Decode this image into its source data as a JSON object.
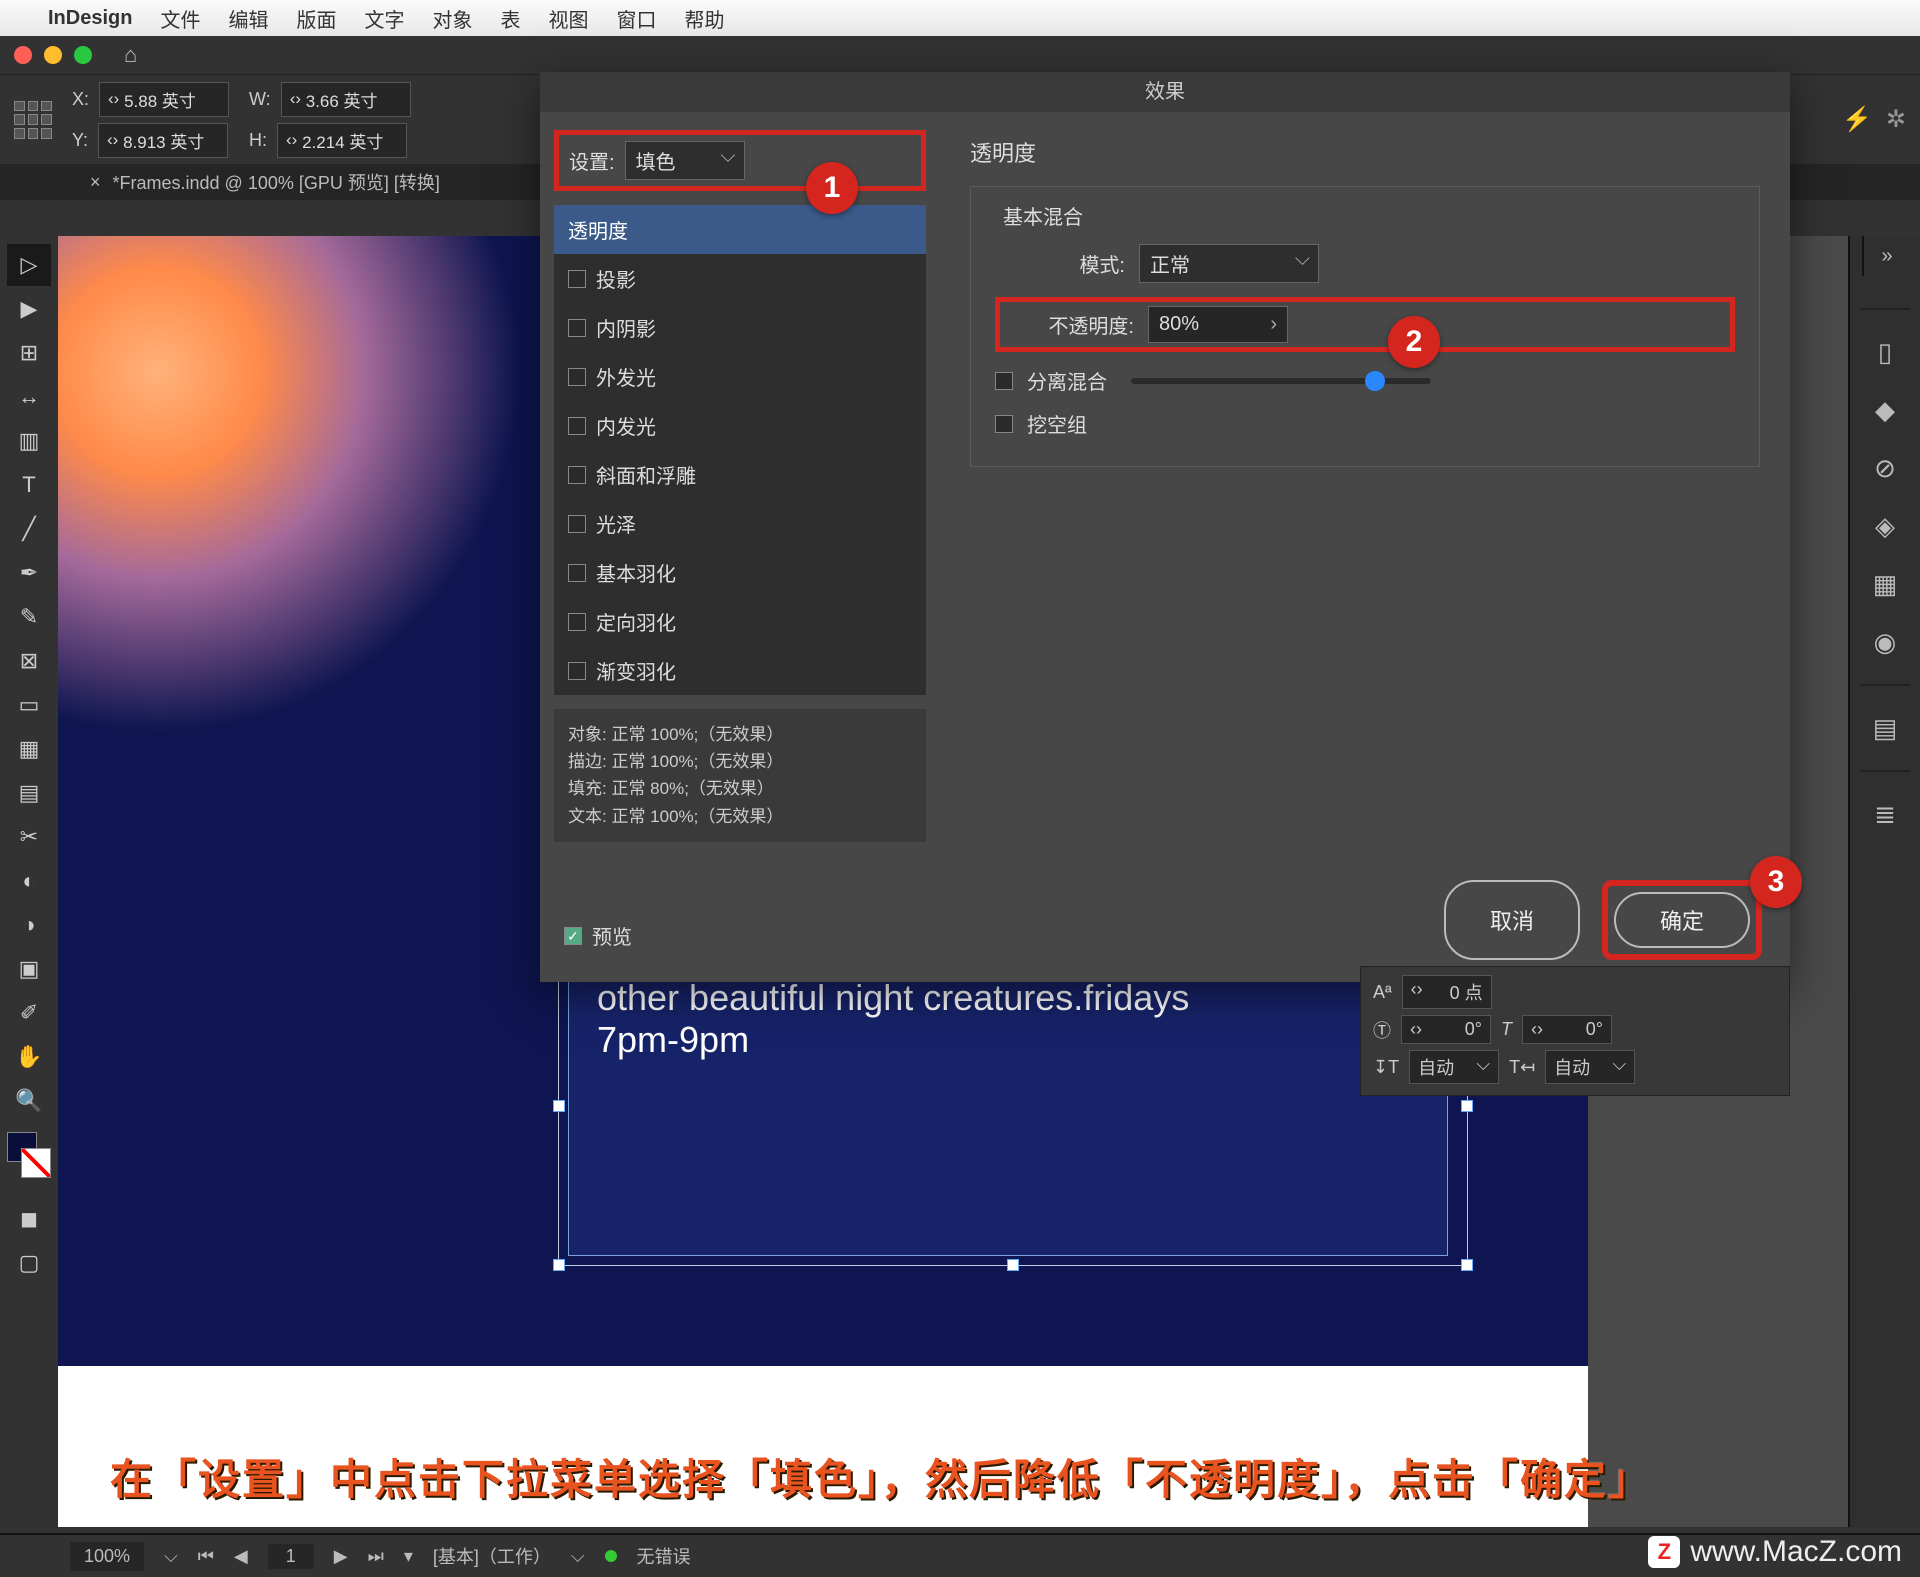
{
  "menubar": {
    "app": "InDesign",
    "items": [
      "文件",
      "编辑",
      "版面",
      "文字",
      "对象",
      "表",
      "视图",
      "窗口",
      "帮助"
    ]
  },
  "controlbar": {
    "x_label": "X:",
    "x_val": "5.88 英寸",
    "y_label": "Y:",
    "y_val": "8.913 英寸",
    "w_label": "W:",
    "w_val": "3.66 英寸",
    "h_label": "H:",
    "h_val": "2.214 英寸"
  },
  "doc_tab": "*Frames.indd @ 100% [GPU 预览] [转换]",
  "dialog": {
    "title": "效果",
    "setting_label": "设置:",
    "setting_value": "填色",
    "fx_items": [
      "透明度",
      "投影",
      "内阴影",
      "外发光",
      "内发光",
      "斜面和浮雕",
      "光泽",
      "基本羽化",
      "定向羽化",
      "渐变羽化"
    ],
    "summary": {
      "l1": "对象: 正常 100%;（无效果）",
      "l2": "描边: 正常 100%;（无效果）",
      "l3": "填充: 正常 80%;（无效果）",
      "l4": "文本: 正常 100%;（无效果）"
    },
    "preview_label": "预览",
    "section_title": "透明度",
    "fieldset_title": "基本混合",
    "mode_label": "模式:",
    "mode_value": "正常",
    "opacity_label": "不透明度:",
    "opacity_value": "80%",
    "isolate_label": "分离混合",
    "knockout_label": "挖空组",
    "cancel": "取消",
    "ok": "确定"
  },
  "textframe": {
    "line1": "other beautiful night creatures.fridays",
    "line2": "7pm-9pm"
  },
  "charpanel": {
    "baseline": "0 点",
    "rot1": "0°",
    "rot2": "0°",
    "auto1": "自动",
    "auto2": "自动"
  },
  "statusbar": {
    "zoom": "100%",
    "workspace": "[基本]（工作）",
    "errors": "无错误"
  },
  "caption": "在「设置」中点击下拉菜单选择「填色」，然后降低「不透明度」，点击「确定」",
  "watermark": "www.MacZ.com",
  "badges": {
    "b1": "1",
    "b2": "2",
    "b3": "3"
  },
  "right_icons": [
    "sliders",
    "cube",
    "pen",
    "link",
    "layers",
    "grid",
    "swatch",
    "separator",
    "menu"
  ]
}
